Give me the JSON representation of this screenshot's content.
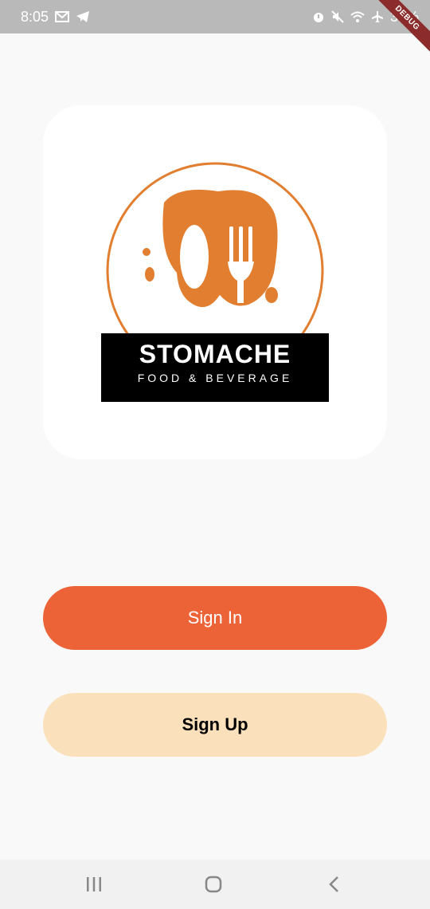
{
  "status_bar": {
    "time": "8:05",
    "battery": "30%",
    "left_icons": [
      "mail-icon",
      "telegram-icon"
    ],
    "right_icons": [
      "alarm-icon",
      "mute-icon",
      "wifi-icon",
      "airplane-icon"
    ]
  },
  "debug_banner": "DEBUG",
  "logo": {
    "title": "STOMACHE",
    "subtitle": "FOOD & BEVERAGE",
    "accent_color": "#e27e2f"
  },
  "actions": {
    "sign_in": "Sign In",
    "sign_up": "Sign Up"
  },
  "colors": {
    "sign_in_bg": "#ec6338",
    "sign_up_bg": "#fbe1bb",
    "background": "#f9f9f9"
  },
  "nav_bar": {
    "icons": [
      "recent-apps-icon",
      "home-icon",
      "back-icon"
    ]
  }
}
